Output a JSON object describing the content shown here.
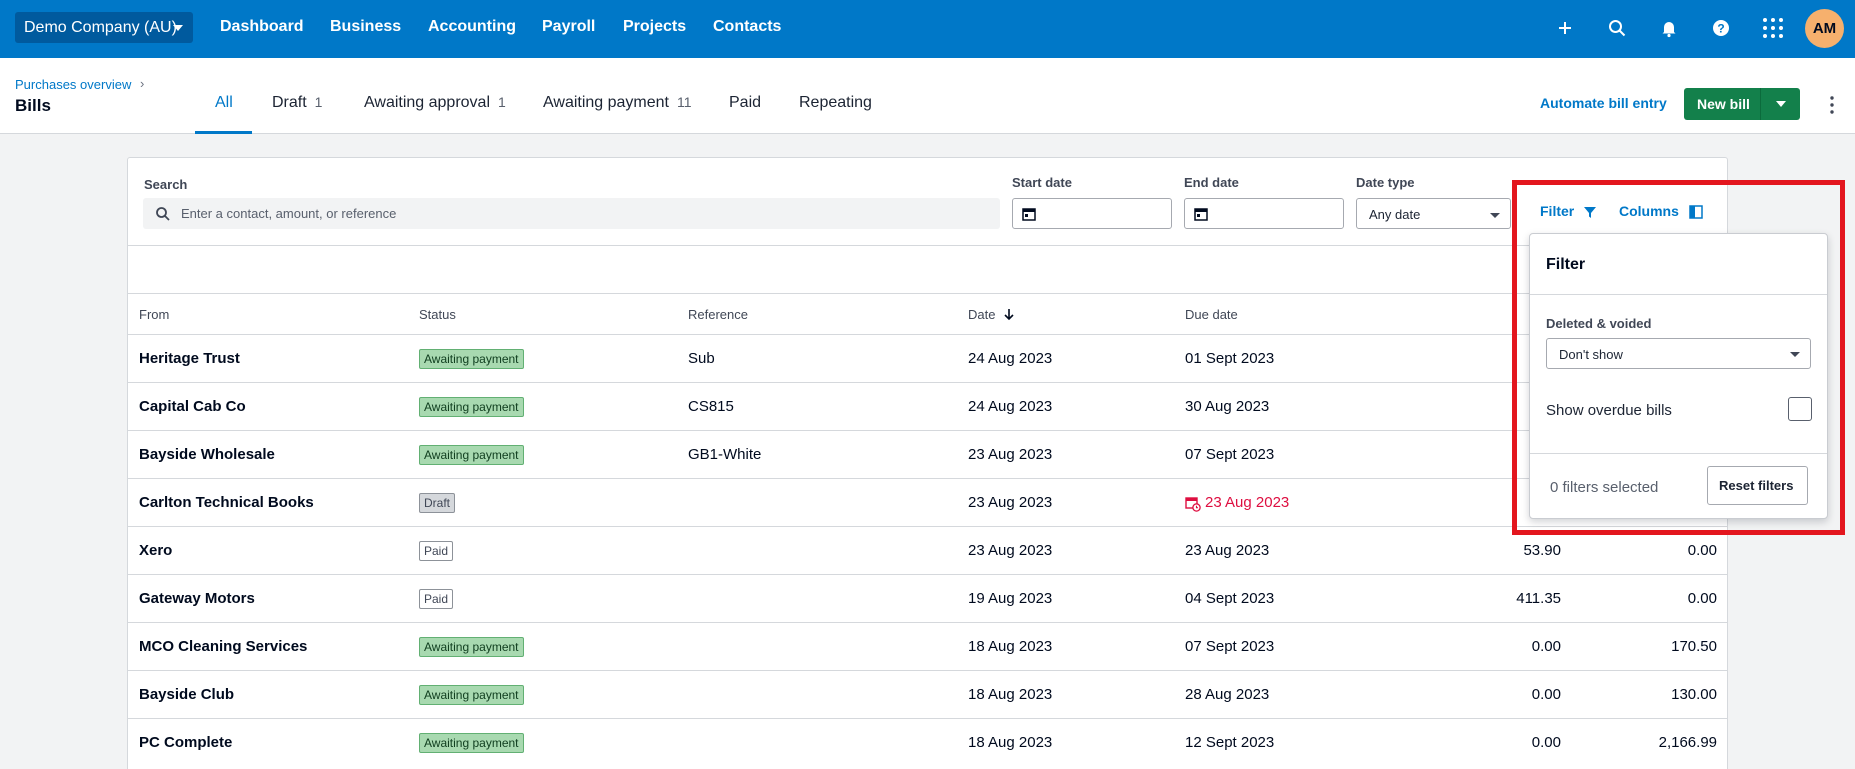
{
  "topnav": {
    "org_name": "Demo Company (AU)",
    "links": [
      "Dashboard",
      "Business",
      "Accounting",
      "Payroll",
      "Projects",
      "Contacts"
    ],
    "avatar_initials": "AM"
  },
  "header": {
    "breadcrumb": "Purchases overview",
    "breadcrumb_sep": "›",
    "title": "Bills",
    "tabs": [
      {
        "label": "All",
        "count": ""
      },
      {
        "label": "Draft",
        "count": "1"
      },
      {
        "label": "Awaiting approval",
        "count": "1"
      },
      {
        "label": "Awaiting payment",
        "count": "11"
      },
      {
        "label": "Paid",
        "count": ""
      },
      {
        "label": "Repeating",
        "count": ""
      }
    ],
    "automate_label": "Automate bill entry",
    "new_bill_label": "New bill"
  },
  "filters": {
    "search_label": "Search",
    "search_placeholder": "Enter a contact, amount, or reference",
    "start_date_label": "Start date",
    "end_date_label": "End date",
    "date_type_label": "Date type",
    "date_type_value": "Any date",
    "filter_label": "Filter",
    "columns_label": "Columns"
  },
  "table": {
    "headers": {
      "from": "From",
      "status": "Status",
      "reference": "Reference",
      "date": "Date",
      "due": "Due date"
    },
    "rows": [
      {
        "from": "Heritage Trust",
        "status": "Awaiting payment",
        "reference": "Sub",
        "date": "24 Aug 2023",
        "due": "01 Sept 2023",
        "paid": "",
        "due_amt": ""
      },
      {
        "from": "Capital Cab Co",
        "status": "Awaiting payment",
        "reference": "CS815",
        "date": "24 Aug 2023",
        "due": "30 Aug 2023",
        "paid": "",
        "due_amt": ""
      },
      {
        "from": "Bayside Wholesale",
        "status": "Awaiting payment",
        "reference": "GB1-White",
        "date": "23 Aug 2023",
        "due": "07 Sept 2023",
        "paid": "",
        "due_amt": ""
      },
      {
        "from": "Carlton Technical Books",
        "status": "Draft",
        "reference": "",
        "date": "23 Aug 2023",
        "due": "23 Aug 2023",
        "paid": "",
        "due_amt": ""
      },
      {
        "from": "Xero",
        "status": "Paid",
        "reference": "",
        "date": "23 Aug 2023",
        "due": "23 Aug 2023",
        "paid": "53.90",
        "due_amt": "0.00"
      },
      {
        "from": "Gateway Motors",
        "status": "Paid",
        "reference": "",
        "date": "19 Aug 2023",
        "due": "04 Sept 2023",
        "paid": "411.35",
        "due_amt": "0.00"
      },
      {
        "from": "MCO Cleaning Services",
        "status": "Awaiting payment",
        "reference": "",
        "date": "18 Aug 2023",
        "due": "07 Sept 2023",
        "paid": "0.00",
        "due_amt": "170.50"
      },
      {
        "from": "Bayside Club",
        "status": "Awaiting payment",
        "reference": "",
        "date": "18 Aug 2023",
        "due": "28 Aug 2023",
        "paid": "0.00",
        "due_amt": "130.00"
      },
      {
        "from": "PC Complete",
        "status": "Awaiting payment",
        "reference": "",
        "date": "18 Aug 2023",
        "due": "12 Sept 2023",
        "paid": "0.00",
        "due_amt": "2,166.99"
      }
    ]
  },
  "filter_popover": {
    "title": "Filter",
    "deleted_label": "Deleted & voided",
    "deleted_value": "Don't show",
    "overdue_label": "Show overdue bills",
    "count_text": "0 filters selected",
    "reset_label": "Reset filters"
  },
  "colors": {
    "brand": "#0078c8",
    "primary_button": "#13804b",
    "overdue": "#de0e40",
    "highlight": "#e3161e"
  }
}
